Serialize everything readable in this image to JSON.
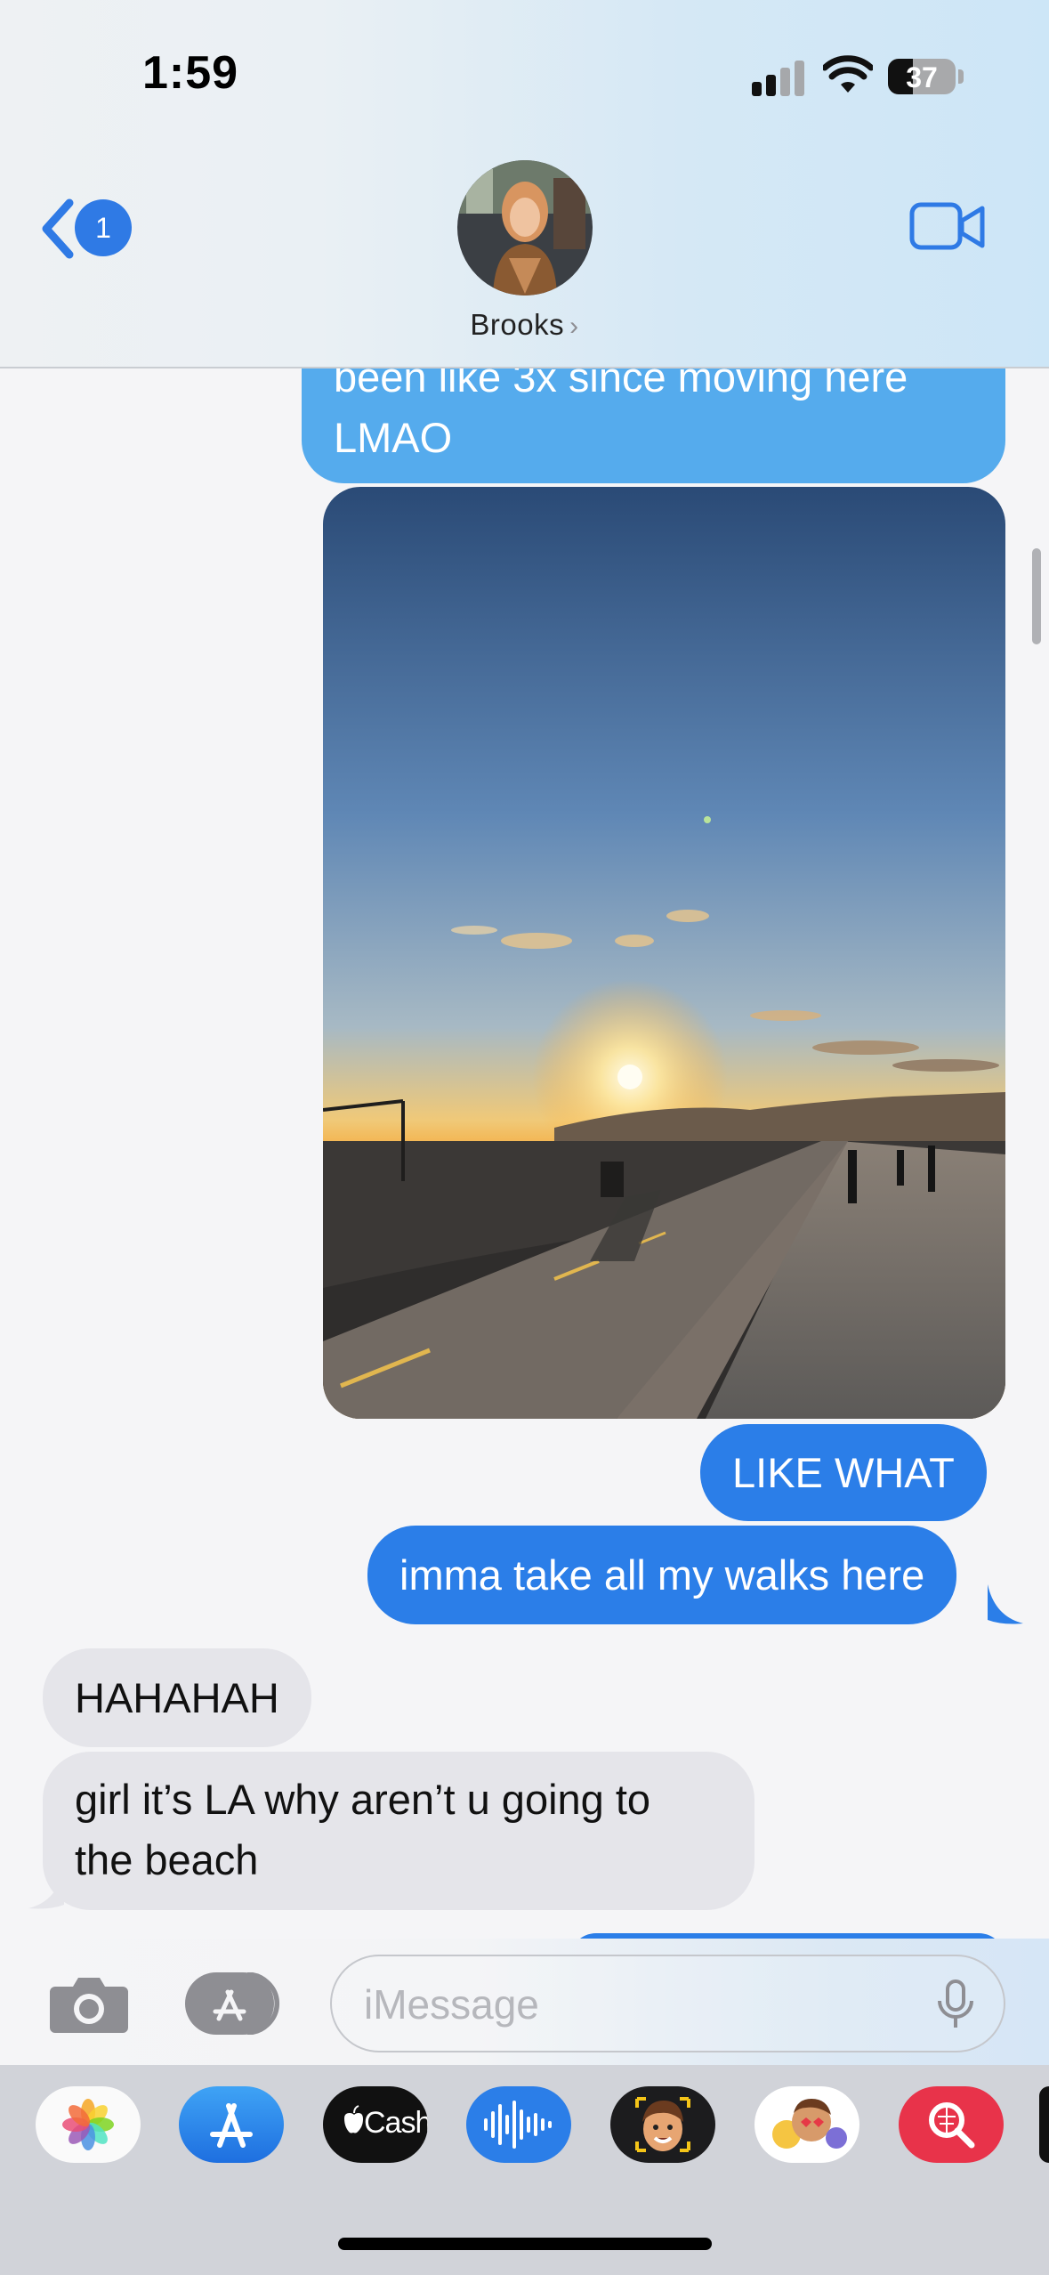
{
  "status_bar": {
    "time": "1:59",
    "battery": "37",
    "battery_level": 0.37,
    "signal_bars_filled": 2,
    "signal_bars_total": 4
  },
  "header": {
    "back_badge": "1",
    "contact_name": "Brooks",
    "name_chevron": "›",
    "colors": {
      "accent": "#2f7ae5"
    }
  },
  "messages": [
    {
      "direction": "out",
      "lines": [
        "been like 3x since moving here",
        "LMAO"
      ]
    },
    {
      "direction": "out",
      "type": "photo"
    },
    {
      "direction": "out",
      "text": "LIKE WHAT"
    },
    {
      "direction": "out",
      "text": "imma take all my walks here"
    },
    {
      "direction": "in",
      "text": "HAHAHAH"
    },
    {
      "direction": "in",
      "lines": [
        "girl it’s LA why aren’t u going to",
        "the beach"
      ]
    }
  ],
  "input": {
    "placeholder": "iMessage",
    "value": ""
  },
  "app_drawer": [
    {
      "icon": "photos-icon"
    },
    {
      "icon": "app-store-icon"
    },
    {
      "icon": "apple-cash-icon",
      "label": "Cash"
    },
    {
      "icon": "audio-message-icon"
    },
    {
      "icon": "memoji-icon"
    },
    {
      "icon": "memoji-stickers-icon"
    },
    {
      "icon": "images-search-icon"
    }
  ]
}
